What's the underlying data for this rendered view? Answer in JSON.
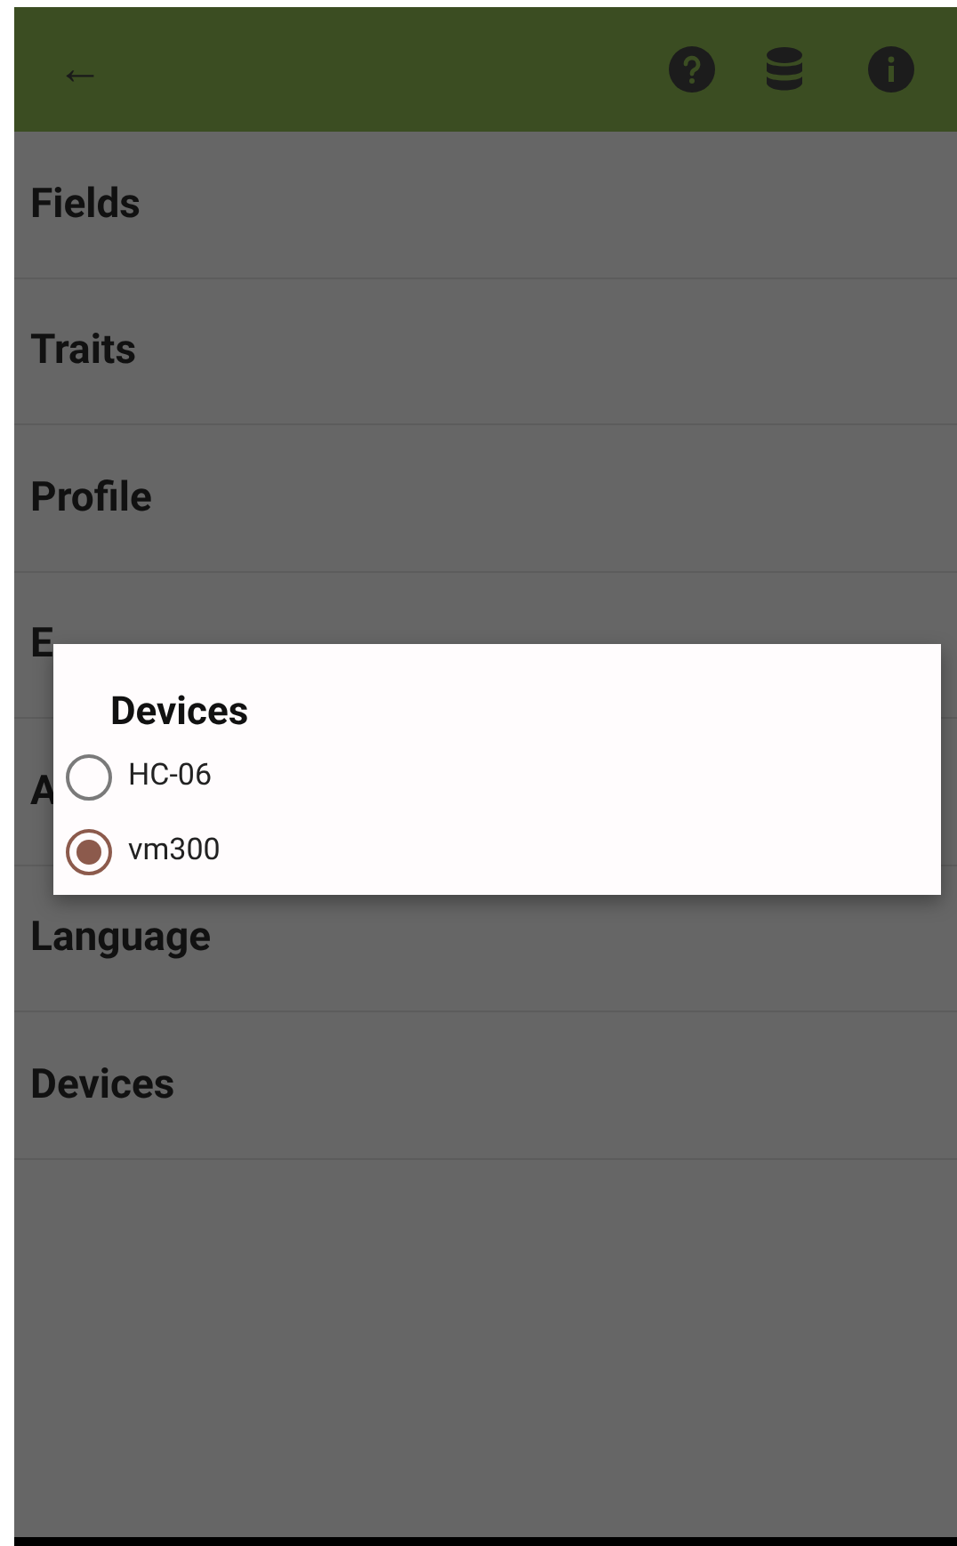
{
  "app_bar": {
    "back": "←"
  },
  "menu": [
    {
      "label": "Fields"
    },
    {
      "label": "Traits"
    },
    {
      "label": "Profile"
    },
    {
      "label": "E"
    },
    {
      "label": "A"
    },
    {
      "label": "Language"
    },
    {
      "label": "Devices"
    }
  ],
  "dialog": {
    "title": "Devices",
    "options": [
      {
        "label": "HC-06",
        "selected": false
      },
      {
        "label": "vm300",
        "selected": true
      }
    ]
  }
}
